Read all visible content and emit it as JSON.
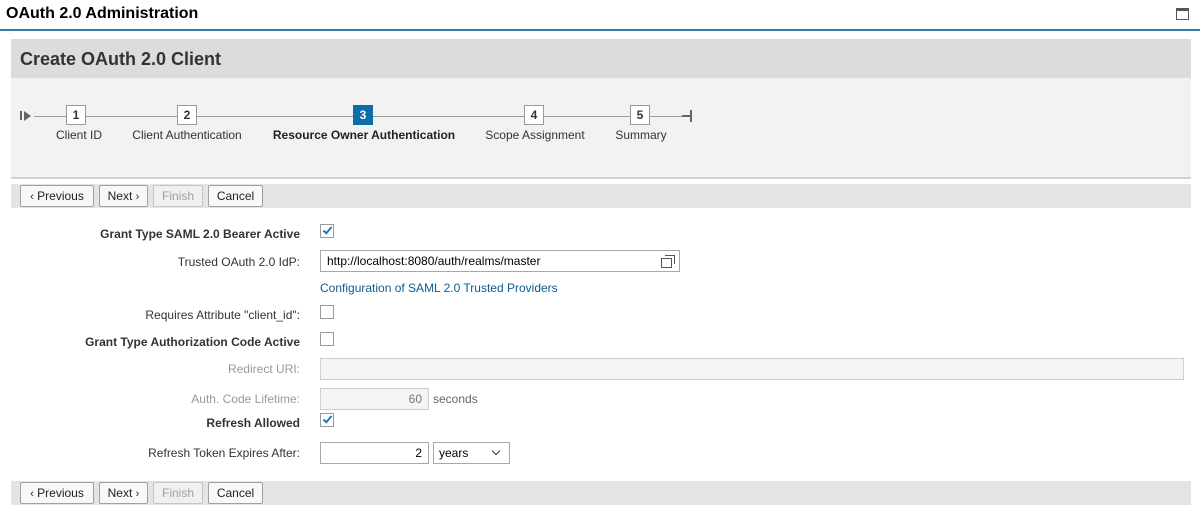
{
  "app": {
    "title": "OAuth 2.0 Administration"
  },
  "panel": {
    "title": "Create OAuth 2.0 Client"
  },
  "roadmap": {
    "steps": [
      {
        "number": "1",
        "label": "Client ID"
      },
      {
        "number": "2",
        "label": "Client Authentication"
      },
      {
        "number": "3",
        "label": "Resource Owner Authentication",
        "active": true
      },
      {
        "number": "4",
        "label": "Scope Assignment"
      },
      {
        "number": "5",
        "label": "Summary"
      }
    ]
  },
  "toolbar": {
    "previous_label": "Previous",
    "next_label": "Next",
    "finish_label": "Finish",
    "cancel_label": "Cancel",
    "previous_chevron": "‹",
    "next_chevron": "›"
  },
  "form": {
    "saml_bearer": {
      "label": "Grant Type SAML 2.0 Bearer Active",
      "checked": true
    },
    "trusted_idp": {
      "label": "Trusted OAuth 2.0 IdP:",
      "value": "http://localhost:8080/auth/realms/master"
    },
    "saml_config_link": "Configuration of SAML 2.0 Trusted Providers",
    "requires_client_id": {
      "label": "Requires Attribute \"client_id\":",
      "checked": false
    },
    "auth_code_active": {
      "label": "Grant Type Authorization Code Active",
      "checked": false
    },
    "redirect_uri": {
      "label": "Redirect URI:",
      "value": ""
    },
    "auth_code_lifetime": {
      "label": "Auth. Code Lifetime:",
      "value": "60",
      "unit": "seconds"
    },
    "refresh_allowed": {
      "label": "Refresh Allowed",
      "checked": true
    },
    "refresh_expires": {
      "label": "Refresh Token Expires After:",
      "value": "2",
      "unit": "years"
    }
  },
  "colors": {
    "accent": "#0a6ea9",
    "header_border": "#2a7fa8",
    "link": "#0a5d91"
  }
}
